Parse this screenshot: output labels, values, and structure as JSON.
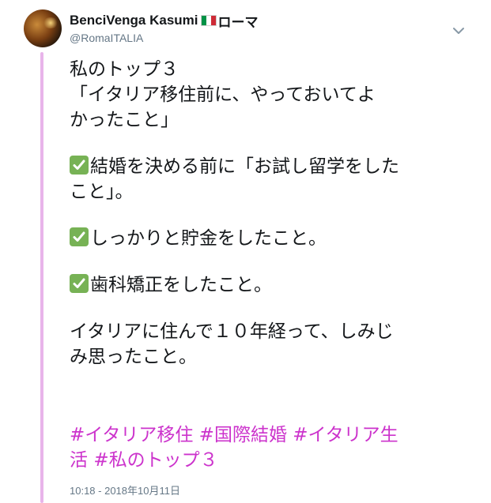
{
  "tweet": {
    "display_name": "BenciVenga Kasumi",
    "name_suffix": "ローマ",
    "handle": "@RomaITALIA",
    "flag_colors": [
      "#009246",
      "#ffffff",
      "#ce2b37"
    ],
    "caret_icon": "chevron-down-icon",
    "body_lines": {
      "l1": "私のトップ３",
      "l2": "「イタリア移住前に、やっておいてよ",
      "l3": "かったこと」",
      "l4": "結婚を決める前に「お試し留学をした",
      "l5": "こと」。",
      "l6": "しっかりと貯金をしたこと。",
      "l7": "歯科矯正をしたこと。",
      "l8": "イタリアに住んで１０年経って、しみじ",
      "l9": "み思ったこと。"
    },
    "check_icon": "check-mark-button-icon",
    "hashtags": {
      "t1": "#イタリア移住",
      "t2": "#国際結婚",
      "t3": "#イタリア生",
      "t3b": "活",
      "t4": "#私のトップ３"
    },
    "timestamp": "10:18 - 2018年10月11日",
    "colors": {
      "hashtag": "#cc33cc",
      "thread_line": "#e8b4ea",
      "check_bg": "#77b255",
      "secondary_text": "#657786"
    }
  }
}
